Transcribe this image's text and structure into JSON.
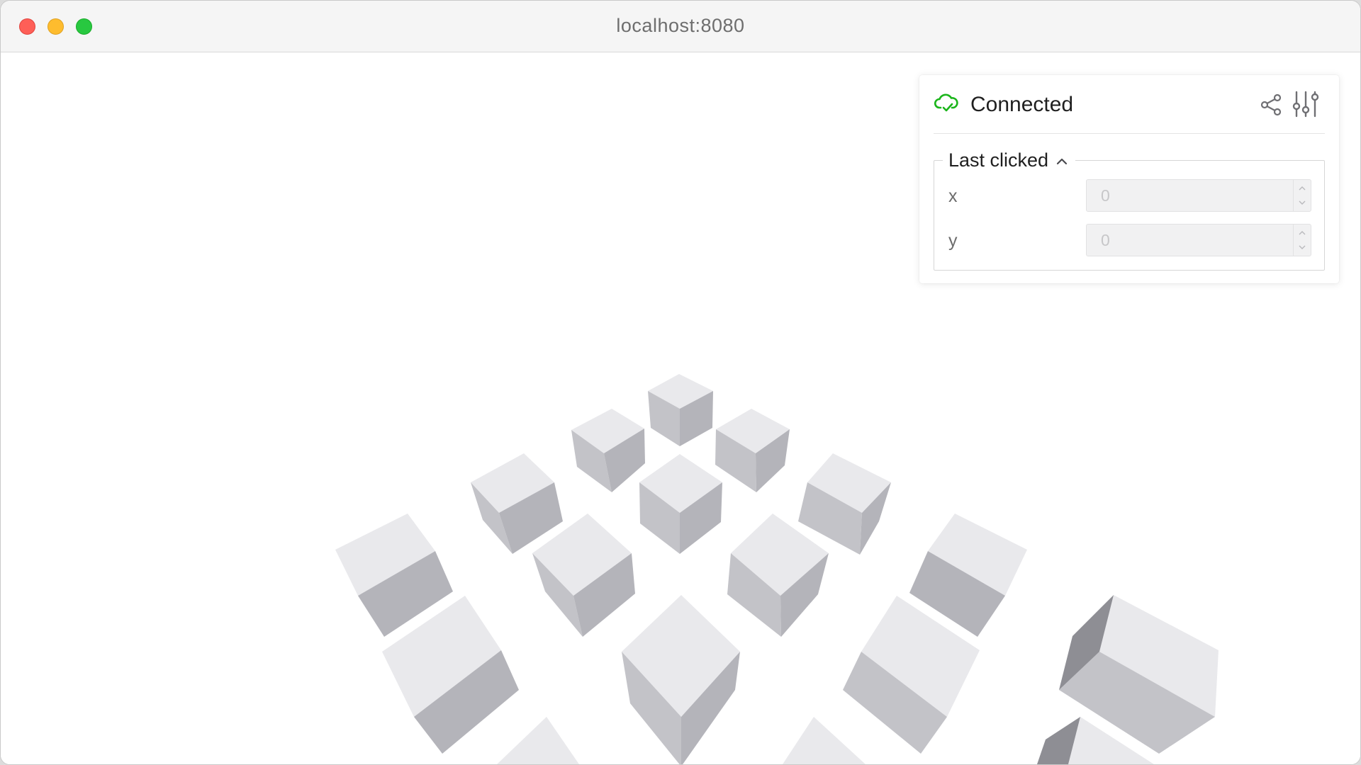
{
  "window": {
    "url": "localhost:8080"
  },
  "controls": {
    "status": "Connected",
    "status_icon": "cloud-check-icon",
    "status_color": "#1bb51b",
    "share_icon": "share-icon",
    "settings_icon": "sliders-icon"
  },
  "last_clicked": {
    "title": "Last clicked",
    "expanded": true,
    "fields": [
      {
        "label": "x",
        "value": "0"
      },
      {
        "label": "y",
        "value": "0"
      }
    ]
  },
  "scene": {
    "description_icon": "cube-grid",
    "face_colors": {
      "top": "#e9e9ec",
      "left": "#c3c3c8",
      "right": "#b4b4ba",
      "dark": "#8e8e94"
    }
  }
}
